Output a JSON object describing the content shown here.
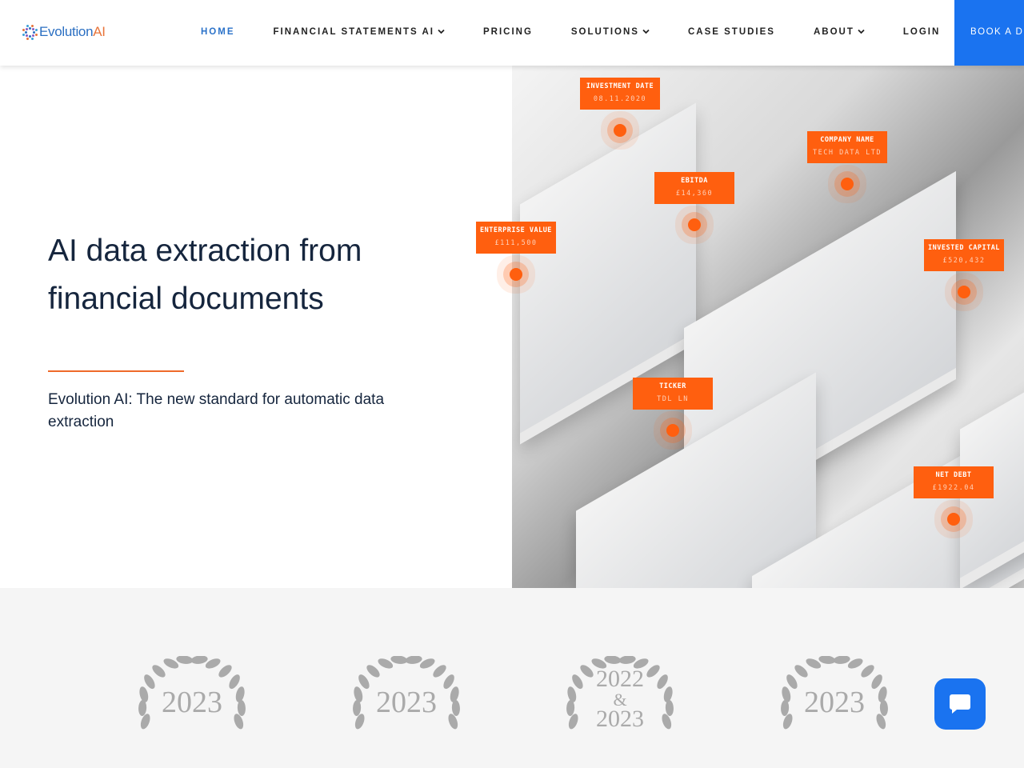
{
  "brand": {
    "name_part1": "Evolution",
    "name_part2": "AI"
  },
  "nav": {
    "items": [
      {
        "label": "HOME",
        "active": true
      },
      {
        "label": "FINANCIAL STATEMENTS AI",
        "dropdown": true
      },
      {
        "label": "PRICING"
      },
      {
        "label": "SOLUTIONS",
        "dropdown": true
      },
      {
        "label": "CASE STUDIES"
      },
      {
        "label": "ABOUT",
        "dropdown": true
      },
      {
        "label": "LOGIN"
      }
    ],
    "cta": "BOOK A DEMO"
  },
  "hero": {
    "title": "AI data extraction from financial documents",
    "subtitle": "Evolution AI: The new standard for automatic data extraction"
  },
  "tags": [
    {
      "label": "INVESTMENT DATE",
      "value": "08.11.2020"
    },
    {
      "label": "COMPANY NAME",
      "value": "TECH DATA LTD"
    },
    {
      "label": "EBITDA",
      "value": "£14,360"
    },
    {
      "label": "ENTERPRISE VALUE",
      "value": "£111,500"
    },
    {
      "label": "INVESTED CAPITAL",
      "value": "£520,432"
    },
    {
      "label": "TICKER",
      "value": "TDL LN"
    },
    {
      "label": "NET DEBT",
      "value": "£1922.04"
    }
  ],
  "awards": [
    {
      "year": "2023"
    },
    {
      "year": "2023"
    },
    {
      "year1": "2022",
      "amp": "&",
      "year2": "2023"
    },
    {
      "year": "2023"
    }
  ],
  "colors": {
    "accent": "#ff5f0f",
    "primary": "#1a73f0",
    "heading": "#15253d"
  },
  "icons": {
    "chat": "chat-bubble-icon",
    "dropdown": "chevron-down-icon"
  }
}
